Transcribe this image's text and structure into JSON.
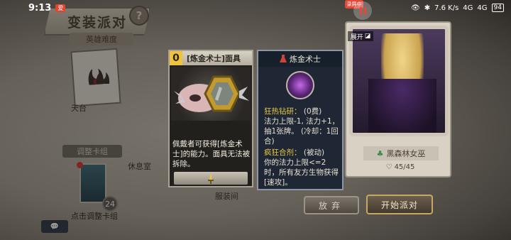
{
  "status_bar": {
    "time": "9:13",
    "app_badge": "爱",
    "network_speed": "7.6 K/s",
    "signal_1": "4G",
    "signal_2": "4G",
    "battery": "94"
  },
  "recording": {
    "pill_label": "录屏中"
  },
  "screen": {
    "title": "变装派对",
    "help_symbol": "?",
    "difficulty": "英雄难度"
  },
  "map": {
    "nodes": {
      "rooftop": "天台",
      "rest_room": "休息室",
      "outfit_room": "服装间"
    },
    "deck": {
      "header": "调整卡组",
      "count": "24",
      "hint": "点击调整卡组"
    },
    "chat_label": "💬"
  },
  "item_card": {
    "cost": "0",
    "title": "[炼金术士]面具",
    "description": "佩戴者可获得[炼金术士]的能力。面具无法被拆除。",
    "footer_icon": "dagger-icon"
  },
  "info_card": {
    "title": "炼金术士",
    "skill1_name": "狂热钻研：",
    "skill1_type": "(0费)",
    "skill1_desc": "法力上限-1, 法力+1，抽1张牌。 (冷却：1回合)",
    "skill2_name": "疯狂合剂：",
    "skill2_type": "(被动)",
    "skill2_desc": "你的法力上限<=2时，所有友方生物获得[速攻]。"
  },
  "character": {
    "expand_label": "展开",
    "name": "黑森林女巫",
    "hp": "45/45"
  },
  "buttons": {
    "give_up": "放弃",
    "start": "开始派对"
  },
  "colors": {
    "cost_gold": "#f0c33c",
    "skill_gold": "#e8c64a",
    "record_red": "#e34a3a"
  }
}
